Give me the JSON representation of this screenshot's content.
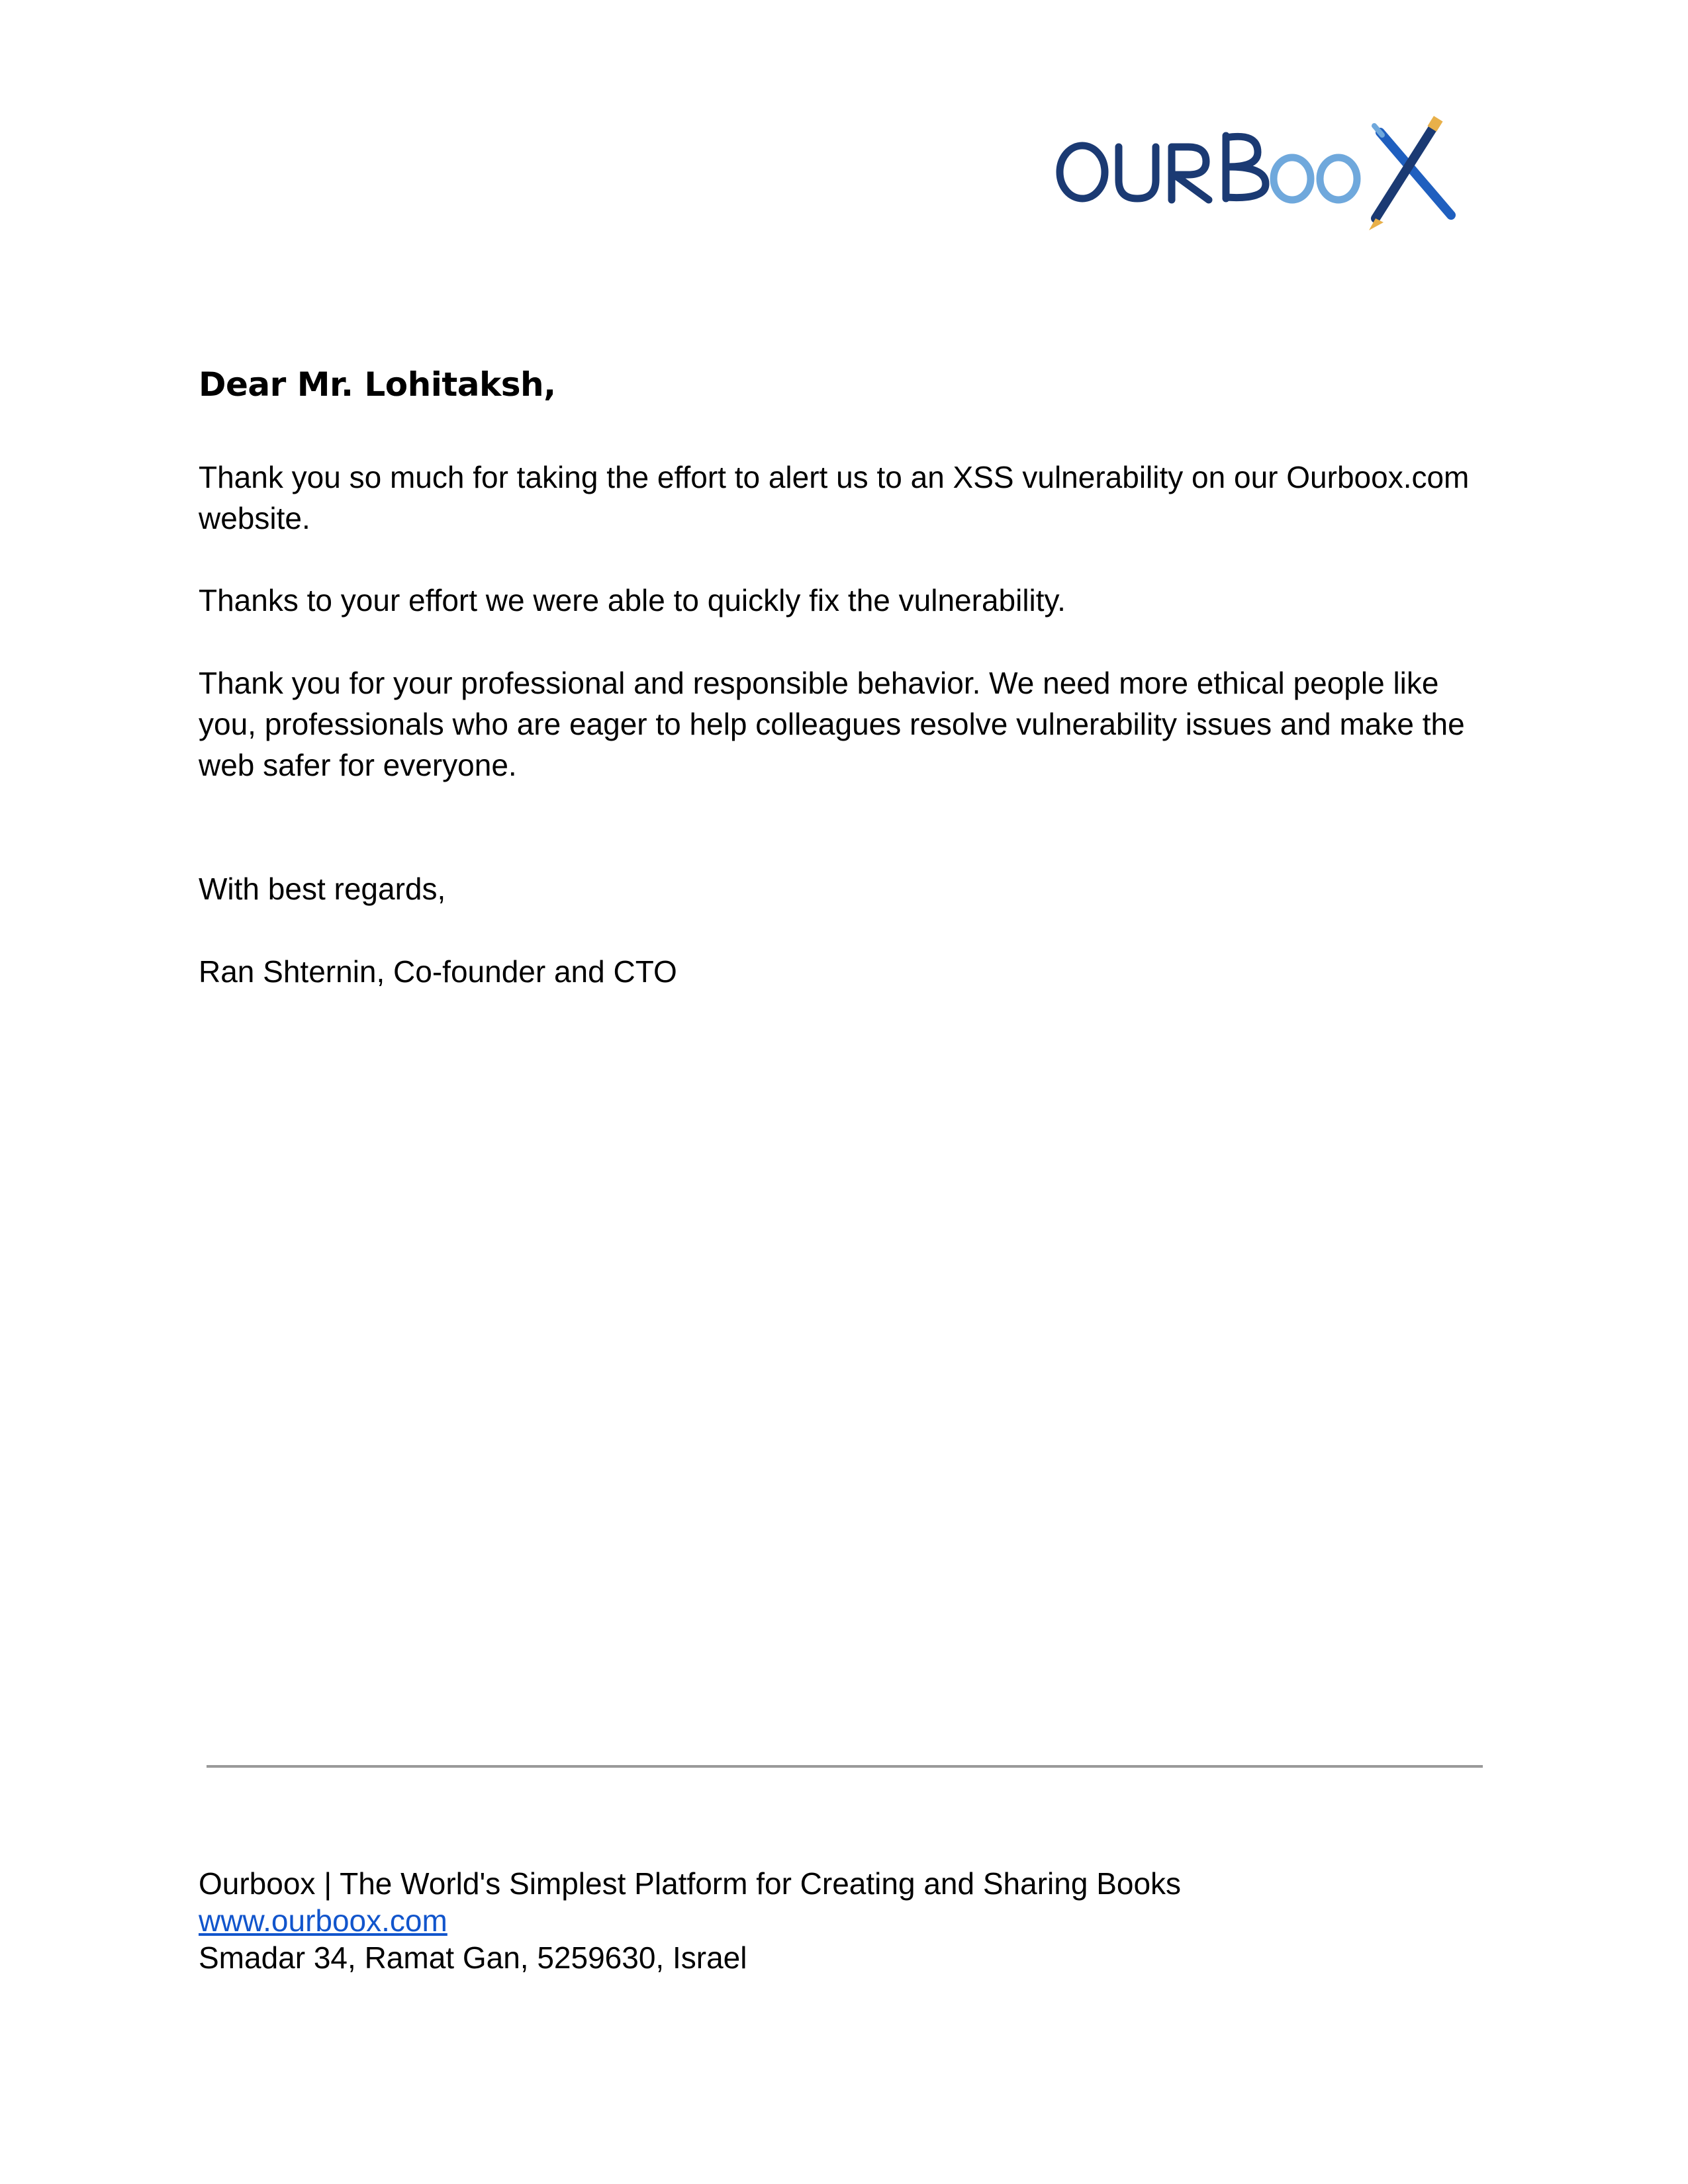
{
  "brand": {
    "logo_text": "OURBOOX",
    "colors": {
      "dark_blue": "#1b3a73",
      "light_blue": "#6fa8dc",
      "brush_blue": "#1f5fbf",
      "pen_gold": "#e8b04a"
    }
  },
  "letter": {
    "greeting": "Dear Mr. Lohitaksh,",
    "paragraphs": [
      "Thank you so much for taking the effort to alert us to an XSS vulnerability on our Ourboox.com website.",
      "Thanks to your effort we were able to quickly fix the vulnerability.",
      "Thank you for your professional and responsible behavior. We need more ethical people like you, professionals who are eager to help colleagues resolve vulnerability issues and make the web safer for everyone."
    ],
    "closing": "With best regards,",
    "signature": "Ran Shternin, Co-founder and CTO"
  },
  "footer": {
    "tagline": "Ourboox | The World's Simplest Platform for Creating and Sharing Books",
    "website": "www.ourboox.com",
    "address": "Smadar 34, Ramat Gan, 5259630, Israel"
  }
}
